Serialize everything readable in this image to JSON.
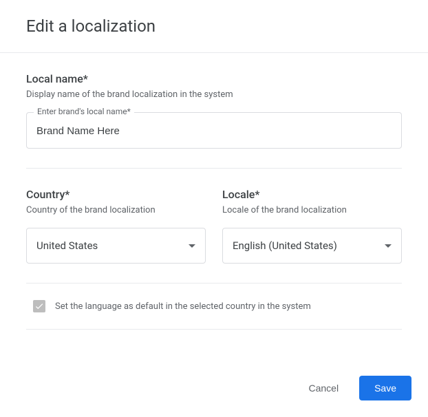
{
  "dialog": {
    "title": "Edit a localization"
  },
  "localName": {
    "label": "Local name*",
    "description": "Display name of the brand localization in the system",
    "fieldLabel": "Enter brand's local name*",
    "value": "Brand Name Here"
  },
  "country": {
    "label": "Country*",
    "description": "Country of the brand localization",
    "selected": "United States"
  },
  "locale": {
    "label": "Locale*",
    "description": "Locale of the brand localization",
    "selected": "English (United States)"
  },
  "defaultLang": {
    "label": "Set the language as default in the selected country in the system",
    "checked": true
  },
  "actions": {
    "cancel": "Cancel",
    "save": "Save"
  }
}
